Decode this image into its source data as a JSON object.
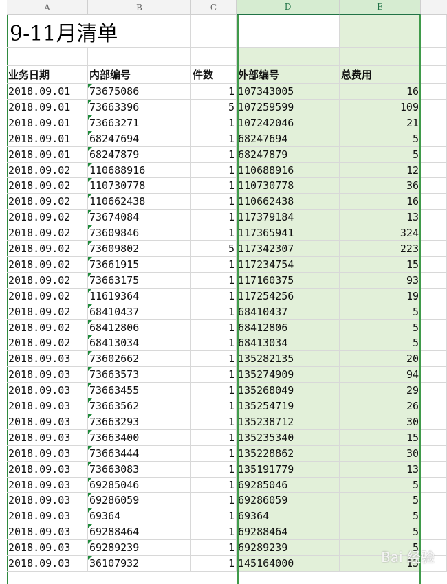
{
  "columns": [
    "A",
    "B",
    "C",
    "D",
    "E"
  ],
  "title": "9-11月清单",
  "headers": {
    "a": "业务日期",
    "b": "内部编号",
    "c": "件数",
    "d": "外部编号",
    "e": "总费用"
  },
  "rows": [
    [
      "2018.09.01",
      "73675086",
      "1",
      "107343005",
      "16"
    ],
    [
      "2018.09.01",
      "73663396",
      "5",
      "107259599",
      "109"
    ],
    [
      "2018.09.01",
      "73663271",
      "1",
      "107242046",
      "21"
    ],
    [
      "2018.09.01",
      "68247694",
      "1",
      "68247694",
      "5"
    ],
    [
      "2018.09.01",
      "68247879",
      "1",
      "68247879",
      "5"
    ],
    [
      "2018.09.02",
      "110688916",
      "1",
      "110688916",
      "12"
    ],
    [
      "2018.09.02",
      "110730778",
      "1",
      "110730778",
      "36"
    ],
    [
      "2018.09.02",
      "110662438",
      "1",
      "110662438",
      "16"
    ],
    [
      "2018.09.02",
      "73674084",
      "1",
      "117379184",
      "13"
    ],
    [
      "2018.09.02",
      "73609846",
      "1",
      "117365941",
      "324"
    ],
    [
      "2018.09.02",
      "73609802",
      "5",
      "117342307",
      "223"
    ],
    [
      "2018.09.02",
      "73661915",
      "1",
      "117234754",
      "15"
    ],
    [
      "2018.09.02",
      "73663175",
      "1",
      "117160375",
      "93"
    ],
    [
      "2018.09.02",
      "11619364",
      "1",
      "117254256",
      "19"
    ],
    [
      "2018.09.02",
      "68410437",
      "1",
      "68410437",
      "5"
    ],
    [
      "2018.09.02",
      "68412806",
      "1",
      "68412806",
      "5"
    ],
    [
      "2018.09.02",
      "68413034",
      "1",
      "68413034",
      "5"
    ],
    [
      "2018.09.03",
      "73602662",
      "1",
      "135282135",
      "20"
    ],
    [
      "2018.09.03",
      "73663573",
      "1",
      "135274909",
      "94"
    ],
    [
      "2018.09.03",
      "73663455",
      "1",
      "135268049",
      "29"
    ],
    [
      "2018.09.03",
      "73663562",
      "1",
      "135254719",
      "26"
    ],
    [
      "2018.09.03",
      "73663293",
      "1",
      "135238712",
      "30"
    ],
    [
      "2018.09.03",
      "73663400",
      "1",
      "135235340",
      "15"
    ],
    [
      "2018.09.03",
      "73663444",
      "1",
      "135228862",
      "30"
    ],
    [
      "2018.09.03",
      "73663083",
      "1",
      "135191779",
      "13"
    ],
    [
      "2018.09.03",
      "69285046",
      "1",
      "69285046",
      "5"
    ],
    [
      "2018.09.03",
      "69286059",
      "1",
      "69286059",
      "5"
    ],
    [
      "2018.09.03",
      "69364",
      "1",
      "69364",
      "5"
    ],
    [
      "2018.09.03",
      "69288464",
      "1",
      "69288464",
      "5"
    ],
    [
      "2018.09.03",
      "69289239",
      "1",
      "69289239",
      "5"
    ],
    [
      "2018.09.03",
      "36107932",
      "1",
      "145164000",
      "13"
    ]
  ],
  "selected_columns": [
    "D",
    "E"
  ],
  "colors": {
    "selection_border": "#3f9a4a",
    "selection_fill": "#e2f0d9",
    "header_bg": "#f3f3f3"
  },
  "watermark": "Bai 经验"
}
